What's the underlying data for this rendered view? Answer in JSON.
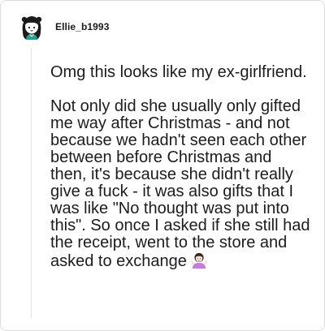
{
  "post": {
    "username": "Ellie_b1993",
    "avatar_icon": "girl-avatar-icon",
    "paragraphs": [
      "Omg this looks like my ex-girlfriend.",
      "Not only did she usually only gifted me way after Christmas - and not because we hadn't seen each other between before Christmas and then, it's because she didn't really give a fuck - it was also gifts that I was like \"No thought was put into this\". So once I asked if she still had the receipt, went to the store and asked to exchange"
    ],
    "trailing_emoji": "person-shrugging-emoji"
  },
  "colors": {
    "text": "#1c1c1c",
    "border": "#dcdcdc",
    "thread_line": "#e6e6e6",
    "avatar_bg": "#2f9e87"
  }
}
